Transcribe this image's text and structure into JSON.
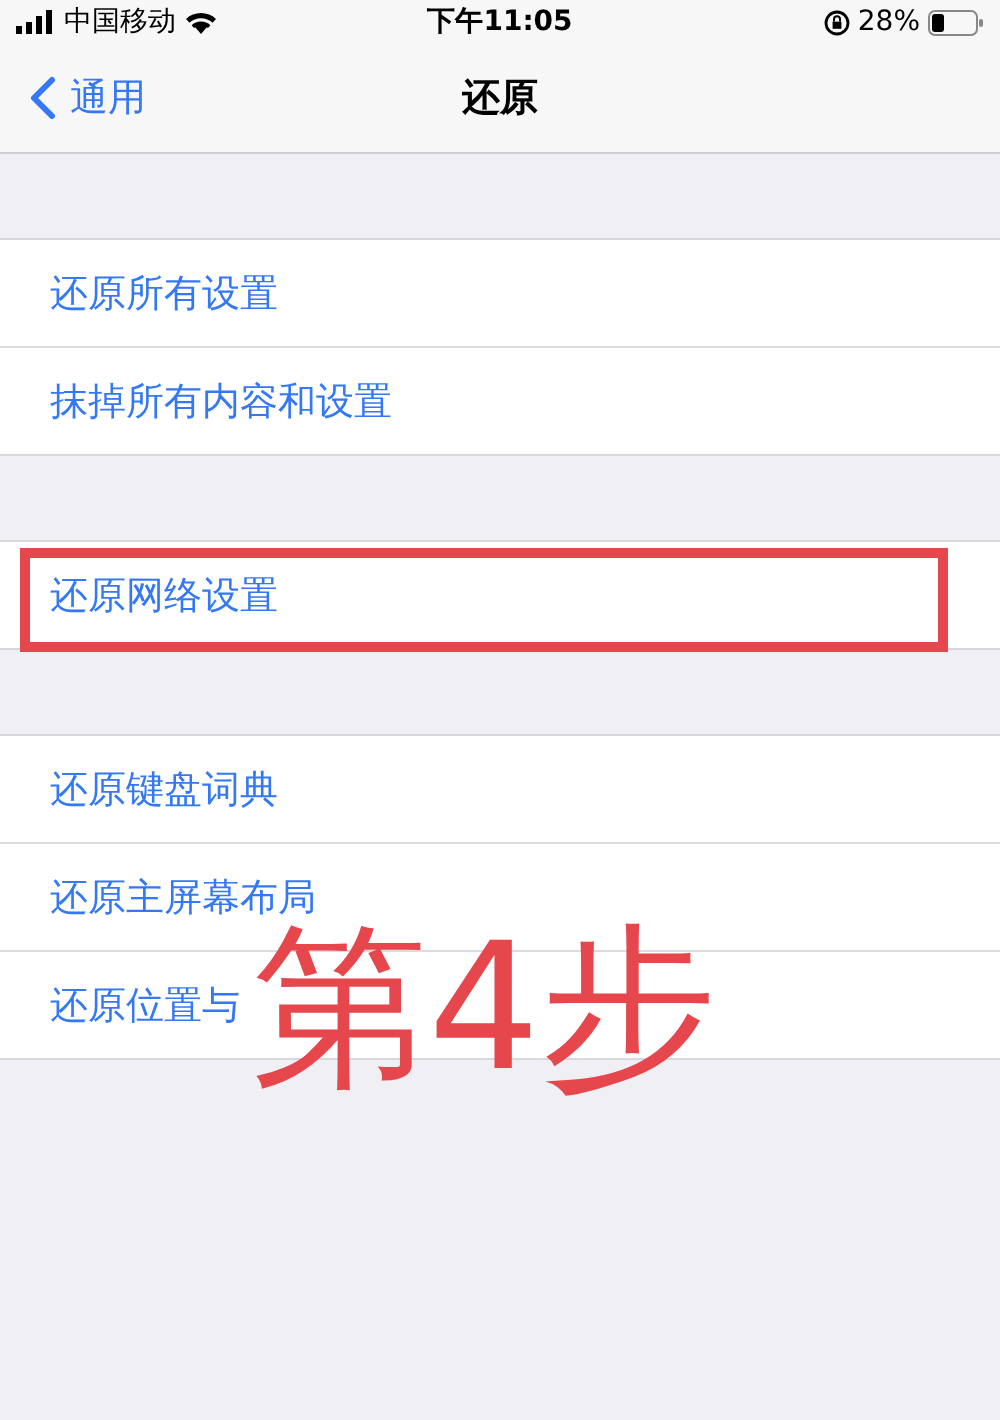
{
  "status_bar": {
    "carrier": "中国移动",
    "time": "下午11:05",
    "battery": "28%"
  },
  "nav": {
    "back": "通用",
    "title": "还原"
  },
  "groups": [
    {
      "rows": [
        {
          "label": "还原所有设置",
          "marked": false
        },
        {
          "label": "抹掉所有内容和设置",
          "marked": false
        }
      ]
    },
    {
      "rows": [
        {
          "label": "还原网络设置",
          "marked": true
        }
      ]
    },
    {
      "rows": [
        {
          "label": "还原键盘词典",
          "marked": false
        },
        {
          "label": "还原主屏幕布局",
          "marked": false
        },
        {
          "label": "还原位置与",
          "marked": false
        }
      ]
    }
  ],
  "annotation": {
    "text": "第4步"
  }
}
